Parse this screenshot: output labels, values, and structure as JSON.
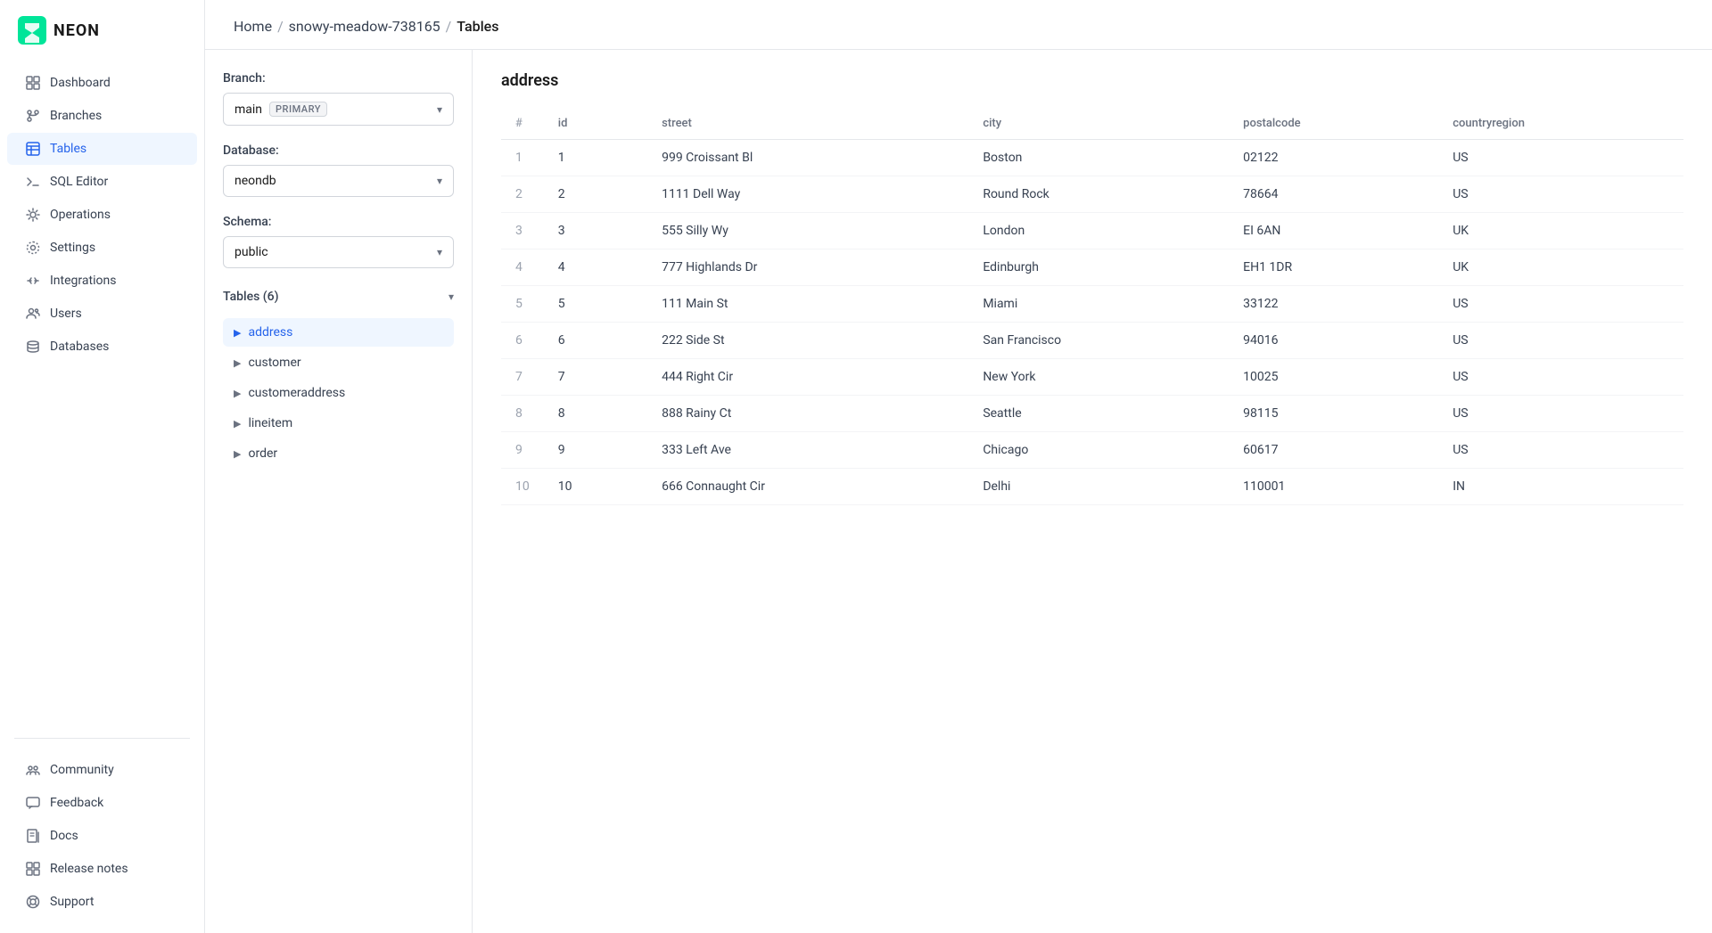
{
  "app": {
    "name": "NEON"
  },
  "breadcrumb": {
    "home": "Home",
    "project": "snowy-meadow-738165",
    "current": "Tables",
    "sep": "/"
  },
  "sidebar": {
    "nav_items": [
      {
        "id": "dashboard",
        "label": "Dashboard",
        "icon": "dashboard-icon"
      },
      {
        "id": "branches",
        "label": "Branches",
        "icon": "branches-icon"
      },
      {
        "id": "tables",
        "label": "Tables",
        "icon": "tables-icon",
        "active": true
      },
      {
        "id": "sql-editor",
        "label": "SQL Editor",
        "icon": "sql-editor-icon"
      },
      {
        "id": "operations",
        "label": "Operations",
        "icon": "operations-icon"
      },
      {
        "id": "settings",
        "label": "Settings",
        "icon": "settings-icon"
      },
      {
        "id": "integrations",
        "label": "Integrations",
        "icon": "integrations-icon"
      },
      {
        "id": "users",
        "label": "Users",
        "icon": "users-icon"
      },
      {
        "id": "databases",
        "label": "Databases",
        "icon": "databases-icon"
      }
    ],
    "bottom_items": [
      {
        "id": "community",
        "label": "Community",
        "icon": "community-icon"
      },
      {
        "id": "feedback",
        "label": "Feedback",
        "icon": "feedback-icon"
      },
      {
        "id": "docs",
        "label": "Docs",
        "icon": "docs-icon"
      },
      {
        "id": "release-notes",
        "label": "Release notes",
        "icon": "release-notes-icon"
      },
      {
        "id": "support",
        "label": "Support",
        "icon": "support-icon"
      }
    ]
  },
  "left_panel": {
    "branch_label": "Branch:",
    "branch_value": "main",
    "branch_badge": "PRIMARY",
    "database_label": "Database:",
    "database_value": "neondb",
    "schema_label": "Schema:",
    "schema_value": "public",
    "tables_label": "Tables (6)",
    "tables": [
      {
        "id": "address",
        "name": "address",
        "active": true
      },
      {
        "id": "customer",
        "name": "customer",
        "active": false
      },
      {
        "id": "customeraddress",
        "name": "customeraddress",
        "active": false
      },
      {
        "id": "lineitem",
        "name": "lineitem",
        "active": false
      },
      {
        "id": "order",
        "name": "order",
        "active": false
      }
    ]
  },
  "table": {
    "title": "address",
    "columns": [
      "#",
      "id",
      "street",
      "city",
      "postalcode",
      "countryregion"
    ],
    "rows": [
      {
        "row_num": "1",
        "id": "1",
        "street": "999 Croissant Bl",
        "city": "Boston",
        "postalcode": "02122",
        "countryregion": "US"
      },
      {
        "row_num": "2",
        "id": "2",
        "street": "1111 Dell Way",
        "city": "Round Rock",
        "postalcode": "78664",
        "countryregion": "US"
      },
      {
        "row_num": "3",
        "id": "3",
        "street": "555 Silly Wy",
        "city": "London",
        "postalcode": "EI 6AN",
        "countryregion": "UK"
      },
      {
        "row_num": "4",
        "id": "4",
        "street": "777 Highlands Dr",
        "city": "Edinburgh",
        "postalcode": "EH1 1DR",
        "countryregion": "UK"
      },
      {
        "row_num": "5",
        "id": "5",
        "street": "111 Main St",
        "city": "Miami",
        "postalcode": "33122",
        "countryregion": "US"
      },
      {
        "row_num": "6",
        "id": "6",
        "street": "222 Side St",
        "city": "San Francisco",
        "postalcode": "94016",
        "countryregion": "US"
      },
      {
        "row_num": "7",
        "id": "7",
        "street": "444 Right Cir",
        "city": "New York",
        "postalcode": "10025",
        "countryregion": "US"
      },
      {
        "row_num": "8",
        "id": "8",
        "street": "888 Rainy Ct",
        "city": "Seattle",
        "postalcode": "98115",
        "countryregion": "US"
      },
      {
        "row_num": "9",
        "id": "9",
        "street": "333 Left Ave",
        "city": "Chicago",
        "postalcode": "60617",
        "countryregion": "US"
      },
      {
        "row_num": "10",
        "id": "10",
        "street": "666 Connaught Cir",
        "city": "Delhi",
        "postalcode": "110001",
        "countryregion": "IN"
      }
    ]
  }
}
